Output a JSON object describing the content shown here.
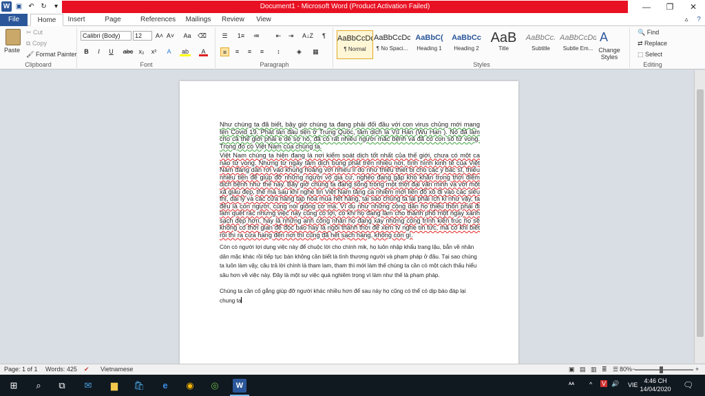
{
  "window": {
    "title": "Document1 - Microsoft Word (Product Activation Failed)",
    "minimize": "—",
    "restore": "❐",
    "close": "✕"
  },
  "qat": {
    "word_icon": "W",
    "save_icon": "💾",
    "undo_icon": "↶",
    "redo_icon": "↻",
    "more_icon": "▾"
  },
  "tabs": [
    "File",
    "Home",
    "Insert",
    "Page Layout",
    "References",
    "Mailings",
    "Review",
    "View"
  ],
  "ribbon": {
    "clipboard": {
      "cut": "Cut",
      "copy": "Copy",
      "paste": "Paste",
      "format_painter": "Format Painter",
      "label": "Clipboard"
    },
    "font": {
      "family": "Calibri (Body)",
      "size": "12",
      "label": "Font",
      "grow": "A˄",
      "shrink": "A˅",
      "case": "Aa",
      "clear": "⌫",
      "bold": "B",
      "italic": "I",
      "underline": "U",
      "strike": "abc",
      "sub": "x₂",
      "sup": "x²",
      "effects": "A",
      "highlight": "ab",
      "color": "A"
    },
    "paragraph": {
      "label": "Paragraph",
      "bullets": "☰",
      "numbering": "1≡",
      "multilevel": "≔",
      "outdent": "⇤",
      "indent": "⇥",
      "sort": "A↓Z",
      "show": "¶",
      "left": "≡",
      "center": "≡",
      "right": "≡",
      "justify": "≡",
      "spacing": "↕",
      "shading": "◈",
      "borders": "▦"
    },
    "styles": {
      "label": "Styles",
      "items": [
        {
          "sample": "AaBbCcDc",
          "name": "¶ Normal"
        },
        {
          "sample": "AaBbCcDc",
          "name": "¶ No Spaci..."
        },
        {
          "sample": "AaBbC(",
          "name": "Heading 1"
        },
        {
          "sample": "AaBbCc",
          "name": "Heading 2"
        },
        {
          "sample": "AaB",
          "name": "Title"
        },
        {
          "sample": "AaBbCc.",
          "name": "Subtitle"
        },
        {
          "sample": "AaBbCcDd",
          "name": "Subtle Em..."
        }
      ],
      "change_styles": "Change Styles"
    },
    "editing": {
      "label": "Editing",
      "find": "Find",
      "replace": "Replace",
      "select": "Select"
    }
  },
  "document": {
    "para1": "Như chúng ta đã biết, bây giờ chúng ta đang phải đối đầu với con virus chủng mới mang tên Covid 19. Phát tán đầu tiện ở Trung Quốc, tâm dịch là Vũ Hán (Wu Han ). Nó đã làm cho cả thế giới phải e dè sợ nó, đã có rất nhiều người mắc bệnh và đã có con số tử vong. Trong đó có Việt Nam của chúng ta.",
    "para2": "Việt Nam chúng ta hiện đang là nơi kiểm soát dịch tốt nhất của thế giới, chưa có một ca nào tử vong. Nhưng từ ngày tâm dịch bùng phát trên nhiều nơi, tình hình kinh tế của Việt Nam đang dần rơi vào khủng hoảng với nhiều lí do như thiếu thiết bị cho các y bác sĩ, thiếu nhiều tiền để giúp đỡ những người vô gia cư, nghèo đang gặp khó khăn trong thời điểm dịch bệnh như thế này. Bây giờ chúng ta đang sống trong một thời đại văn minh và với một xã giàu đẹp, thế mà sau khi nghe tin Việt Nam tăng ca nhiễm mới liền đổ xô đi vào các siêu thị, đại lý và các cửa hàng tạp hóa mua hết hàng, tại sao chúng ta lại phải ích kỉ như vậy, ta đều là con người, cùng nòi giống cơ mà. Ví dụ như những công dân họ thiếu thốn phải đi làm quét rác nhưng việc này cũng có lợi, có khi họ đang làm cho thành phố một ngày xanh sạch đẹp hơn, hay là những anh công nhân họ đang xây những công trình kiến trúc họ sẽ không có thời gian để đọc báo hay là ngồi thành thơi để xem tv nghe tin tức, mà có khi biết rồi thì ra cửa hàng đến nơi thì cũng đã hết sạch hàng, không còn gì.",
    "para3": "Còn có người lợi dụng việc này để chuộc lời cho chính mik, họ luôn nhập khẩu trang lậu, bẫn về nhân dân mặc khác rồi tiếp tục bán không cần biết là tình thương người và phạm pháp ở đâu. Tại sao chúng ta luôn làm vậy, câu trả lời chính là tham lam, tham thì mới làm thế chúng ta cần có một cách thấu hiểu sâu hơn về việc này. Đây là một sự việc quá nghiêm trọng vì làm như thế là phạm pháp.",
    "para4": "Chúng ta cần cố gắng giúp đỡ người khác nhiều hơn để sau này họ cũng có thể có dịp báo đáp lại chung ta"
  },
  "status": {
    "page": "Page: 1 of 1",
    "words": "Words: 425",
    "language": "Vietnamese",
    "zoom": "80%",
    "zoom_minus": "−",
    "zoom_plus": "+"
  },
  "taskbar": {
    "time": "4:46 CH",
    "date": "14/04/2020",
    "lang": "VIE",
    "tray_a": "ᴬᴬ",
    "tray_up": "^"
  }
}
